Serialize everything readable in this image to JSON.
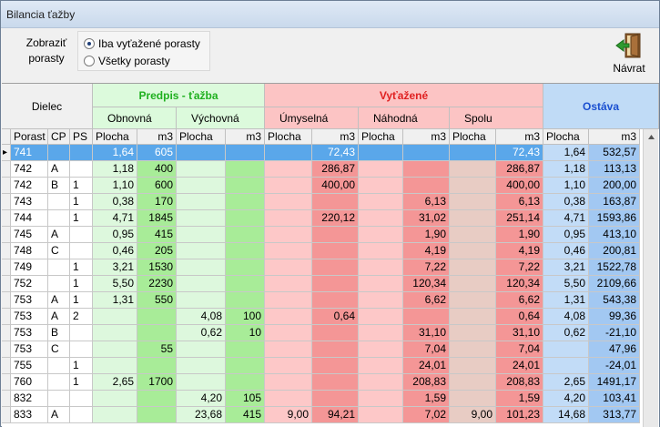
{
  "window": {
    "title": "Bilancia ťažby"
  },
  "show_label": "Zobraziť porasty",
  "radio": {
    "option1": "Iba vyťažené porasty",
    "option2": "Všetky porasty",
    "selected": 1
  },
  "back_button": {
    "label": "Návrat",
    "icon": "exit-door-icon"
  },
  "groups": {
    "dielec": "Dielec",
    "predpis": "Predpis - ťažba",
    "vytazene": "Vyťažené",
    "ostava": "Ostáva"
  },
  "subgroups": {
    "obnovna": "Obnovná",
    "vychovna": "Výchovná",
    "umyselna": "Úmyselná",
    "nahodna": "Náhodná",
    "spolu": "Spolu"
  },
  "columns": [
    "Porast",
    "CP",
    "PS",
    "Plocha",
    "m3",
    "Plocha",
    "m3",
    "Plocha",
    "m3",
    "Plocha",
    "m3",
    "Plocha",
    "m3",
    "Plocha",
    "m3"
  ],
  "rows": [
    [
      "741",
      "",
      "",
      "1,64",
      "605",
      "",
      "",
      "",
      "72,43",
      "",
      "",
      "",
      "72,43",
      "1,64",
      "532,57"
    ],
    [
      "742",
      "A",
      "",
      "1,18",
      "400",
      "",
      "",
      "",
      "286,87",
      "",
      "",
      "",
      "286,87",
      "1,18",
      "113,13"
    ],
    [
      "742",
      "B",
      "1",
      "1,10",
      "600",
      "",
      "",
      "",
      "400,00",
      "",
      "",
      "",
      "400,00",
      "1,10",
      "200,00"
    ],
    [
      "743",
      "",
      "1",
      "0,38",
      "170",
      "",
      "",
      "",
      "",
      "",
      "6,13",
      "",
      "6,13",
      "0,38",
      "163,87"
    ],
    [
      "744",
      "",
      "1",
      "4,71",
      "1845",
      "",
      "",
      "",
      "220,12",
      "",
      "31,02",
      "",
      "251,14",
      "4,71",
      "1593,86"
    ],
    [
      "745",
      "A",
      "",
      "0,95",
      "415",
      "",
      "",
      "",
      "",
      "",
      "1,90",
      "",
      "1,90",
      "0,95",
      "413,10"
    ],
    [
      "748",
      "C",
      "",
      "0,46",
      "205",
      "",
      "",
      "",
      "",
      "",
      "4,19",
      "",
      "4,19",
      "0,46",
      "200,81"
    ],
    [
      "749",
      "",
      "1",
      "3,21",
      "1530",
      "",
      "",
      "",
      "",
      "",
      "7,22",
      "",
      "7,22",
      "3,21",
      "1522,78"
    ],
    [
      "752",
      "",
      "1",
      "5,50",
      "2230",
      "",
      "",
      "",
      "",
      "",
      "120,34",
      "",
      "120,34",
      "5,50",
      "2109,66"
    ],
    [
      "753",
      "A",
      "1",
      "1,31",
      "550",
      "",
      "",
      "",
      "",
      "",
      "6,62",
      "",
      "6,62",
      "1,31",
      "543,38"
    ],
    [
      "753",
      "A",
      "2",
      "",
      "",
      "4,08",
      "100",
      "",
      "0,64",
      "",
      "",
      "",
      "0,64",
      "4,08",
      "99,36"
    ],
    [
      "753",
      "B",
      "",
      "",
      "",
      "0,62",
      "10",
      "",
      "",
      "",
      "31,10",
      "",
      "31,10",
      "0,62",
      "-21,10"
    ],
    [
      "753",
      "C",
      "",
      "",
      "55",
      "",
      "",
      "",
      "",
      "",
      "7,04",
      "",
      "7,04",
      "",
      "47,96"
    ],
    [
      "755",
      "",
      "1",
      "",
      "",
      "",
      "",
      "",
      "",
      "",
      "24,01",
      "",
      "24,01",
      "",
      "-24,01"
    ],
    [
      "760",
      "",
      "1",
      "2,65",
      "1700",
      "",
      "",
      "",
      "",
      "",
      "208,83",
      "",
      "208,83",
      "2,65",
      "1491,17"
    ],
    [
      "832",
      "",
      "",
      "",
      "",
      "4,20",
      "105",
      "",
      "",
      "",
      "1,59",
      "",
      "1,59",
      "4,20",
      "103,41"
    ],
    [
      "833",
      "A",
      "",
      "",
      "",
      "23,68",
      "415",
      "9,00",
      "94,21",
      "",
      "7,02",
      "9,00",
      "101,23",
      "14,68",
      "313,77"
    ]
  ],
  "colors": {
    "green_light": "#ddf8dd",
    "green_dark": "#a8ec98",
    "red_light": "#fdc8c8",
    "red_dark": "#f49696",
    "spolu_light": "#e8ccc4",
    "blue_light": "#c2dcf7",
    "blue_dark": "#a2c8f2",
    "selected": "#5aa7ea"
  },
  "selected_row": 0
}
